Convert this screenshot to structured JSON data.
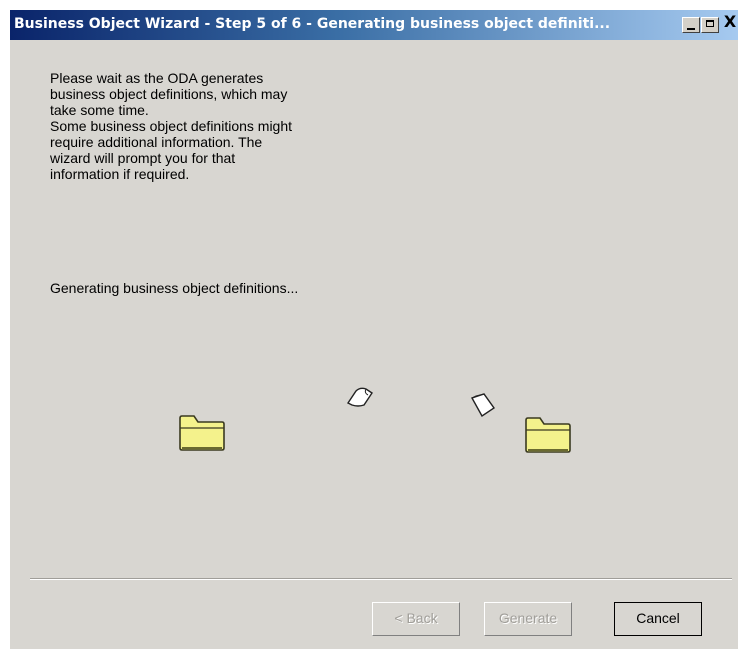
{
  "window": {
    "title": "Business Object Wizard - Step 5 of 6 - Generating business object definiti...",
    "minimize_icon": "minimize-icon",
    "maximize_icon": "maximize-icon",
    "close_label": "X"
  },
  "content": {
    "intro_lines": [
      "Please wait as the ODA generates",
      "business object definitions, which may",
      "take some time.",
      "Some business object definitions might",
      "require additional information. The",
      "wizard will prompt you for that",
      "information if required."
    ],
    "status": "Generating business object definitions...",
    "animation": {
      "source_icon": "folder-icon",
      "destination_icon": "folder-icon",
      "moving_icon": "document-icon",
      "folder_color": "#f4f28c"
    }
  },
  "buttons": {
    "back": "< Back",
    "generate": "Generate",
    "cancel": "Cancel"
  }
}
